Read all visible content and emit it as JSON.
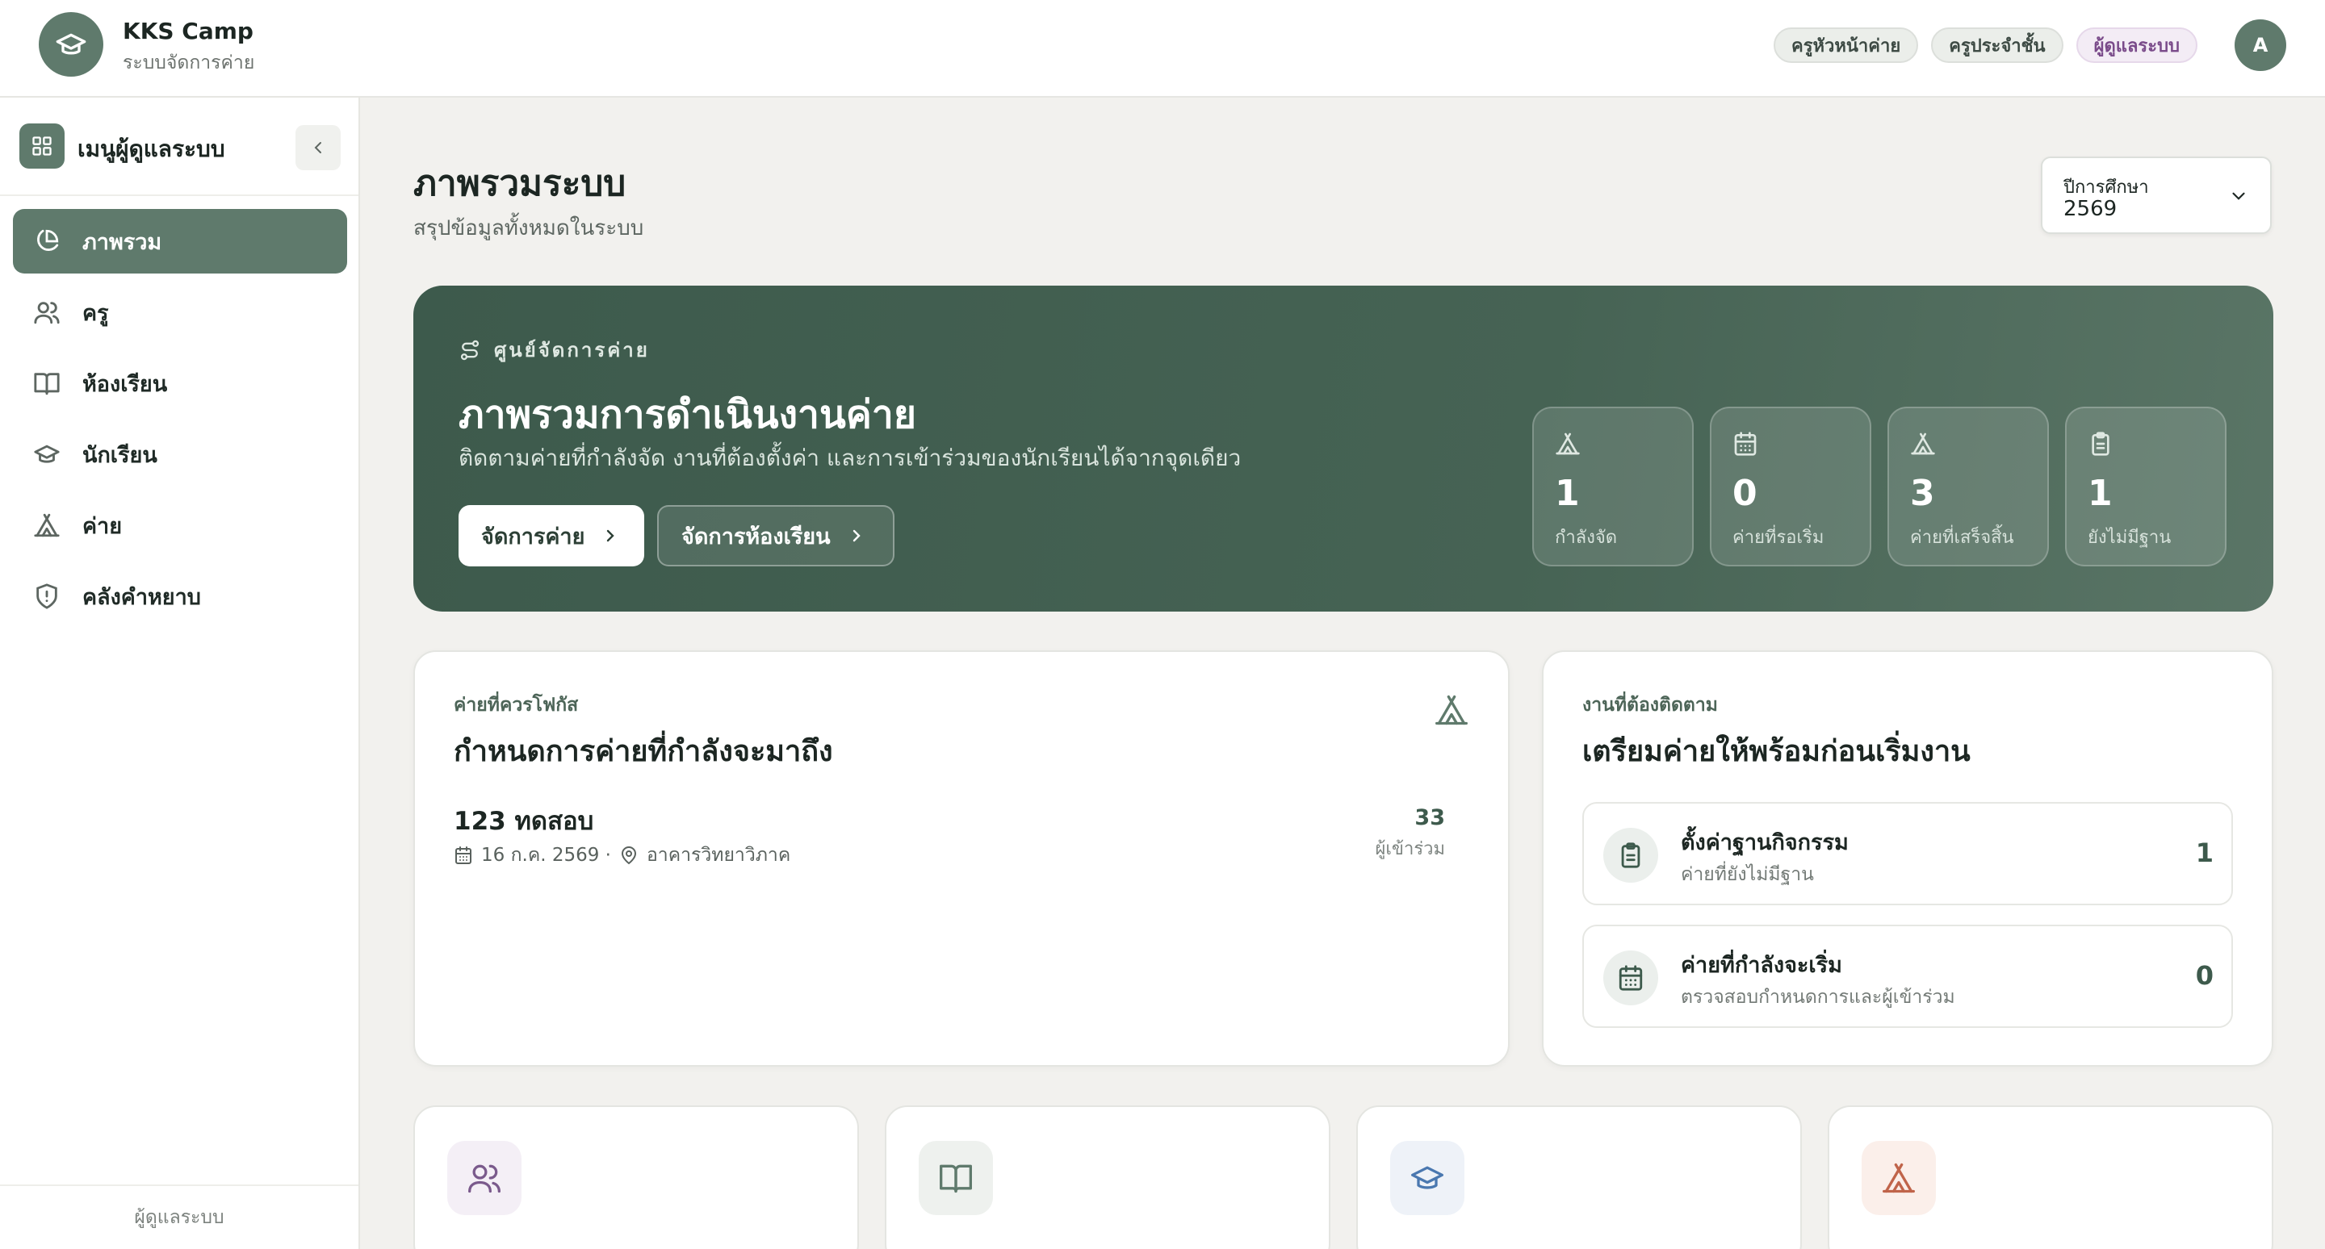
{
  "brand": {
    "title": "KKS Camp",
    "subtitle": "ระบบจัดการค่าย"
  },
  "header": {
    "roles": [
      "ครูหัวหน้าค่าย",
      "ครูประจำชั้น",
      "ผู้ดูแลระบบ"
    ],
    "active_role_index": 2,
    "avatar_letter": "A"
  },
  "sidebar": {
    "title": "เมนูผู้ดูแลระบบ",
    "items": [
      {
        "label": "ภาพรวม",
        "icon": "pie-chart-icon",
        "active": true
      },
      {
        "label": "ครู",
        "icon": "users-icon"
      },
      {
        "label": "ห้องเรียน",
        "icon": "book-icon"
      },
      {
        "label": "นักเรียน",
        "icon": "graduation-cap-icon"
      },
      {
        "label": "ค่าย",
        "icon": "tent-icon"
      },
      {
        "label": "คลังคำหยาบ",
        "icon": "shield-alert-icon"
      }
    ],
    "footer": "ผู้ดูแลระบบ"
  },
  "page": {
    "title": "ภาพรวมระบบ",
    "subtitle": "สรุปข้อมูลทั้งหมดในระบบ"
  },
  "year_select": {
    "label": "ปีการศึกษา",
    "value": "2569"
  },
  "hero": {
    "eyebrow": "ศูนย์จัดการค่าย",
    "title": "ภาพรวมการดำเนินงานค่าย",
    "subtitle": "ติดตามค่ายที่กำลังจัด งานที่ต้องตั้งค่า และการเข้าร่วมของนักเรียนได้จากจุดเดียว",
    "primary_button": "จัดการค่าย",
    "secondary_button": "จัดการห้องเรียน",
    "stats": [
      {
        "value": "1",
        "label": "กำลังจัด",
        "icon": "tent-icon"
      },
      {
        "value": "0",
        "label": "ค่ายที่รอเริ่ม",
        "icon": "calendar-icon"
      },
      {
        "value": "3",
        "label": "ค่ายที่เสร็จสิ้น",
        "icon": "tent-icon"
      },
      {
        "value": "1",
        "label": "ยังไม่มีฐาน",
        "icon": "clipboard-icon"
      }
    ]
  },
  "focus": {
    "eyebrow": "ค่ายที่ควรโฟกัส",
    "title": "กำหนดการค่ายที่กำลังจะมาถึง",
    "camp": {
      "name": "123 ทดสอบ",
      "date": "16 ก.ค. 2569 ·",
      "location": "อาคารวิทยาวิภาค",
      "participants": "33",
      "participants_label": "ผู้เข้าร่วม"
    }
  },
  "tasks": {
    "eyebrow": "งานที่ต้องติดตาม",
    "title": "เตรียมค่ายให้พร้อมก่อนเริ่มงาน",
    "items": [
      {
        "title": "ตั้งค่าฐานกิจกรรม",
        "subtitle": "ค่ายที่ยังไม่มีฐาน",
        "count": "1",
        "icon": "clipboard-icon"
      },
      {
        "title": "ค่ายที่กำลังจะเริ่ม",
        "subtitle": "ตรวจสอบกำหนดการและผู้เข้าร่วม",
        "count": "0",
        "icon": "calendar-icon"
      }
    ]
  },
  "summary_cards": [
    {
      "icon": "users-icon",
      "color": "#7a5a8c",
      "bg": "#f4eff6"
    },
    {
      "icon": "book-icon",
      "color": "#5f7a6c",
      "bg": "#eef1ee"
    },
    {
      "icon": "graduation-cap-icon",
      "color": "#4a78b0",
      "bg": "#eef2f8"
    },
    {
      "icon": "tent-icon",
      "color": "#c0644a",
      "bg": "#fbefea"
    }
  ],
  "colors": {
    "primary": "#5f7a6c",
    "hero": "#3d5a4c",
    "accent_role": "#7a4b8a"
  }
}
